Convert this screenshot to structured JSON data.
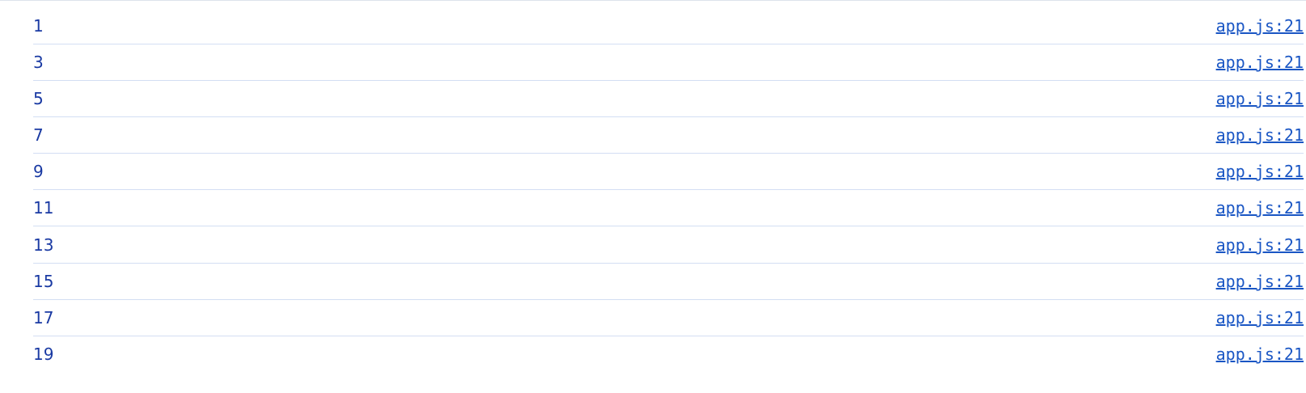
{
  "console": {
    "rows": [
      {
        "message": "1",
        "source": "app.js:21"
      },
      {
        "message": "3",
        "source": "app.js:21"
      },
      {
        "message": "5",
        "source": "app.js:21"
      },
      {
        "message": "7",
        "source": "app.js:21"
      },
      {
        "message": "9",
        "source": "app.js:21"
      },
      {
        "message": "11",
        "source": "app.js:21"
      },
      {
        "message": "13",
        "source": "app.js:21"
      },
      {
        "message": "15",
        "source": "app.js:21"
      },
      {
        "message": "17",
        "source": "app.js:21"
      },
      {
        "message": "19",
        "source": "app.js:21"
      }
    ]
  },
  "colors": {
    "message_text": "#1a3aa3",
    "link_text": "#1a56c4",
    "row_divider": "#d3def3"
  }
}
